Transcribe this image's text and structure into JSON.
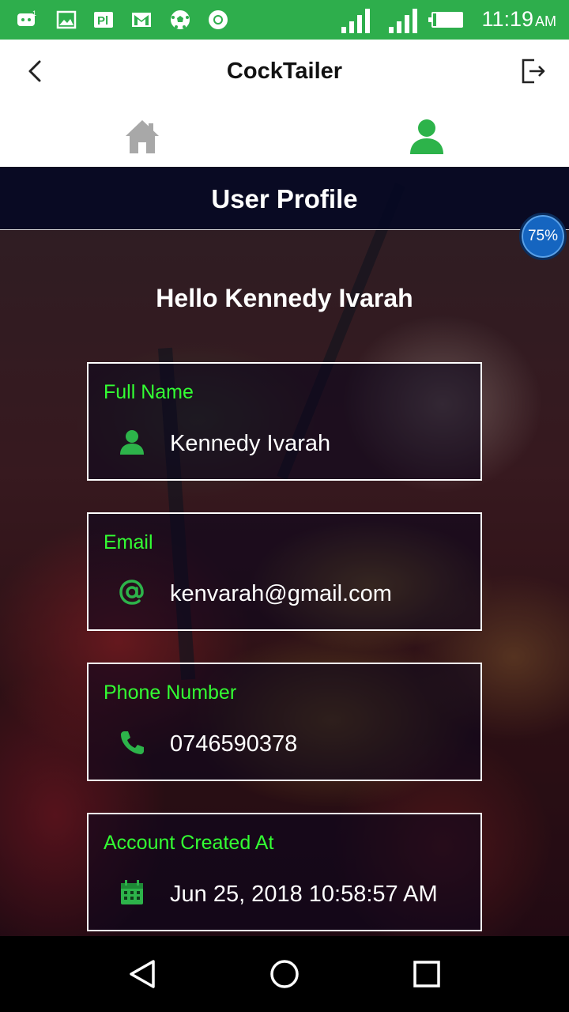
{
  "status_bar": {
    "time": "11:19",
    "ampm": "AM",
    "battery_level": 0.9,
    "icons": [
      "messaging-icon",
      "gallery-icon",
      "publisher-icon",
      "gmail-icon",
      "soccer-icon",
      "chrome-icon"
    ]
  },
  "app_bar": {
    "title": "CockTailer",
    "back_icon": "chevron-left-icon",
    "logout_icon": "logout-icon"
  },
  "tabs": [
    {
      "name": "home",
      "icon": "home-icon",
      "active": false
    },
    {
      "name": "profile",
      "icon": "user-icon",
      "active": true
    }
  ],
  "page": {
    "title": "User Profile",
    "greeting": "Hello Kennedy Ivarah"
  },
  "fields": [
    {
      "label": "Full Name",
      "value": "Kennedy Ivarah",
      "icon": "user-icon"
    },
    {
      "label": "Email",
      "value": "kenvarah@gmail.com",
      "icon": "at-sign-icon"
    },
    {
      "label": "Phone Number",
      "value": "0746590378",
      "icon": "phone-icon"
    },
    {
      "label": "Account Created At",
      "value": "Jun 25, 2018 10:58:57 AM",
      "icon": "calendar-icon"
    }
  ],
  "progress_badge": "75%",
  "colors": {
    "status_bar": "#2eae4c",
    "accent_green": "#33ff33",
    "icon_green": "#2db34a",
    "header_band": "#050823"
  }
}
